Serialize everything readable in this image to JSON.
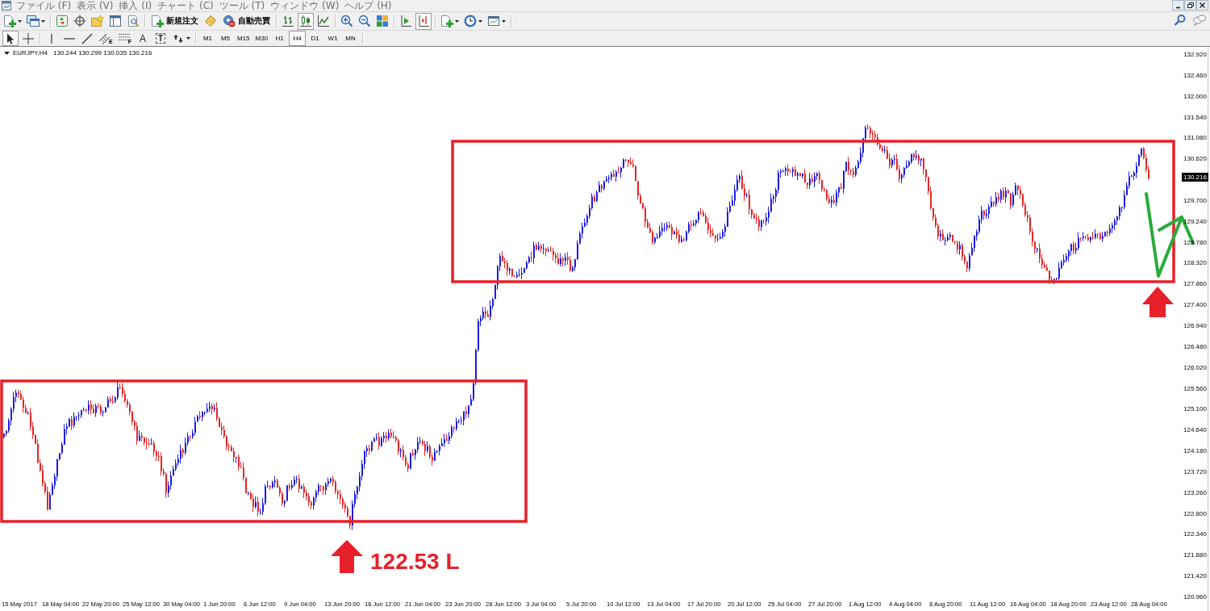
{
  "menu_bar": {
    "items": [
      "ファイル (F)",
      "表示 (V)",
      "挿入 (I)",
      "チャート (C)",
      "ツール (T)",
      "ウィンドウ (W)",
      "ヘルプ (H)"
    ],
    "window_controls": [
      {
        "kind": "minimize"
      },
      {
        "kind": "restore"
      },
      {
        "kind": "close"
      }
    ]
  },
  "toolbar": {
    "groups": [
      [
        {
          "kind": "new-chart",
          "dropdown": true
        },
        {
          "kind": "profiles",
          "dropdown": true
        }
      ],
      [
        {
          "kind": "market-watch"
        },
        {
          "kind": "navigator"
        },
        {
          "kind": "favorites"
        },
        {
          "kind": "terminal"
        },
        {
          "kind": "tester"
        }
      ],
      [
        {
          "kind": "new-order",
          "label": "新規注文"
        },
        {
          "kind": "editor"
        },
        {
          "kind": "auto-trading",
          "label": "自動売買"
        }
      ],
      [
        {
          "kind": "bar-chart",
          "selected": false
        },
        {
          "kind": "candle-chart",
          "selected": true
        },
        {
          "kind": "line-chart",
          "selected": false
        }
      ],
      [
        {
          "kind": "zoom-in"
        },
        {
          "kind": "zoom-out"
        },
        {
          "kind": "tile"
        }
      ],
      [
        {
          "kind": "auto-scroll",
          "on": false
        },
        {
          "kind": "chart-shift",
          "on": true
        }
      ],
      [
        {
          "kind": "indicators",
          "dropdown": true
        },
        {
          "kind": "periods",
          "dropdown": true
        },
        {
          "kind": "templates",
          "dropdown": true
        }
      ]
    ],
    "right": [
      {
        "kind": "search"
      },
      {
        "kind": "chat"
      }
    ]
  },
  "drawing_toolbar": {
    "groups": [
      [
        {
          "kind": "cursor",
          "selected": true
        },
        {
          "kind": "crosshair",
          "selected": false
        }
      ],
      [
        {
          "kind": "vertical-line",
          "selected": false
        },
        {
          "kind": "horizontal-line",
          "selected": false
        },
        {
          "kind": "trend-line",
          "selected": false
        },
        {
          "kind": "channel",
          "glyph": "E",
          "selected": false
        },
        {
          "kind": "fibonacci",
          "glyph": "F",
          "selected": false
        },
        {
          "kind": "text",
          "glyph": "A",
          "selected": false
        },
        {
          "kind": "label",
          "glyph": "T",
          "selected": false
        },
        {
          "kind": "arrows",
          "dropdown": true,
          "selected": false
        }
      ]
    ],
    "periods": [
      {
        "label": "M1",
        "selected": false
      },
      {
        "label": "M5",
        "selected": false
      },
      {
        "label": "M15",
        "selected": false
      },
      {
        "label": "M30",
        "selected": false
      },
      {
        "label": "H1",
        "selected": false
      },
      {
        "label": "H4",
        "selected": true
      },
      {
        "label": "D1",
        "selected": false
      },
      {
        "label": "W1",
        "selected": false
      },
      {
        "label": "MN",
        "selected": false
      }
    ]
  },
  "chart": {
    "symbol": "EURJPY,H4",
    "quotes": "130.244 130.299 130.035 130.216",
    "price_axis": [
      "132.920",
      "132.460",
      "132.000",
      "131.540",
      "131.080",
      "130.620",
      "129.700",
      "129.240",
      "128.780",
      "128.320",
      "127.860",
      "127.400",
      "126.940",
      "126.480",
      "126.020",
      "125.560",
      "125.100",
      "124.640",
      "124.180",
      "123.720",
      "123.260",
      "122.800",
      "122.340",
      "121.880",
      "121.420",
      "120.960"
    ],
    "current_price": "130.216",
    "time_axis": [
      "15 May 2017",
      "18 May 04:00",
      "22 May 20:00",
      "25 May 12:00",
      "30 May 04:00",
      "1 Jun 20:00",
      "6 Jun 12:00",
      "9 Jun 04:00",
      "13 Jun 20:00",
      "16 Jun 12:00",
      "21 Jun 04:00",
      "23 Jun 20:00",
      "28 Jun 12:00",
      "3 Jul 04:00",
      "5 Jul 20:00",
      "10 Jul 12:00",
      "13 Jul 04:00",
      "17 Jul 20:00",
      "20 Jul 12:00",
      "25 Jul 04:00",
      "27 Jul 20:00",
      "1 Aug 12:00",
      "4 Aug 04:00",
      "8 Aug 20:00",
      "11 Aug 12:00",
      "16 Aug 04:00",
      "18 Aug 20:00",
      "23 Aug 12:00",
      "28 Aug 04:00"
    ],
    "low_label": "122.53 L"
  }
}
